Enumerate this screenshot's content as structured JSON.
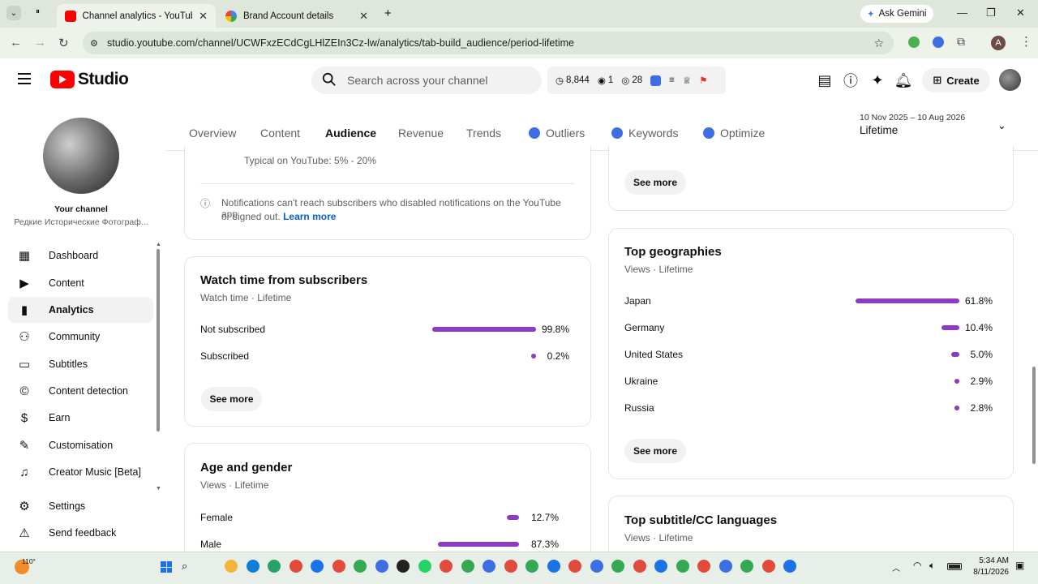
{
  "browser": {
    "tabs": [
      {
        "title": "Channel analytics - YouTube Stu",
        "active": true
      },
      {
        "title": "Brand Account details",
        "active": false
      }
    ],
    "ask_gemini": "Ask Gemini",
    "url": "studio.youtube.com/channel/UCWFxzECdCgLHlZEIn3Cz-lw/analytics/tab-build_audience/period-lifetime",
    "profile_initial": "A"
  },
  "header": {
    "logo_text": "Studio",
    "search_placeholder": "Search across your channel",
    "stats": {
      "watch": "8,844",
      "live": "1",
      "views": "28"
    },
    "create_label": "Create"
  },
  "sidebar": {
    "channel_label": "Your channel",
    "channel_name": "Редкие Исторические Фотограф...",
    "items": [
      {
        "label": "Dashboard",
        "icon": "dashboard-icon"
      },
      {
        "label": "Content",
        "icon": "content-icon"
      },
      {
        "label": "Analytics",
        "icon": "analytics-icon"
      },
      {
        "label": "Community",
        "icon": "community-icon"
      },
      {
        "label": "Subtitles",
        "icon": "subtitles-icon"
      },
      {
        "label": "Content detection",
        "icon": "copyright-icon"
      },
      {
        "label": "Earn",
        "icon": "dollar-icon"
      },
      {
        "label": "Customisation",
        "icon": "magic-wand-icon"
      },
      {
        "label": "Creator Music [Beta]",
        "icon": "music-icon"
      }
    ],
    "settings_label": "Settings",
    "feedback_label": "Send feedback"
  },
  "tabs": [
    "Overview",
    "Content",
    "Audience",
    "Revenue",
    "Trends",
    "Outliers",
    "Keywords",
    "Optimize"
  ],
  "period": {
    "range": "10 Nov 2025 – 10 Aug 2026",
    "label": "Lifetime"
  },
  "notif_card": {
    "typical": "Typical on YouTube: 5% - 20%",
    "note": "Notifications can't reach subscribers who disabled notifications on the YouTube app",
    "note2": "or signed out.",
    "learn_more": "Learn more"
  },
  "watch_time_card": {
    "title": "Watch time from subscribers",
    "subtitle": "Watch time · Lifetime",
    "rows": [
      {
        "label": "Not subscribed",
        "value": 99.8,
        "text": "99.8%"
      },
      {
        "label": "Subscribed",
        "value": 0.2,
        "text": "0.2%"
      }
    ],
    "see_more": "See more"
  },
  "age_gender_card": {
    "title": "Age and gender",
    "subtitle": "Views · Lifetime",
    "rows": [
      {
        "label": "Female",
        "value": 12.7,
        "text": "12.7%"
      },
      {
        "label": "Male",
        "value": 87.3,
        "text": "87.3%"
      }
    ]
  },
  "top_card": {
    "see_more": "See more"
  },
  "geo_card": {
    "title": "Top geographies",
    "subtitle": "Views · Lifetime",
    "rows": [
      {
        "label": "Japan",
        "value": 61.8,
        "text": "61.8%"
      },
      {
        "label": "Germany",
        "value": 10.4,
        "text": "10.4%"
      },
      {
        "label": "United States",
        "value": 5.0,
        "text": "5.0%"
      },
      {
        "label": "Ukraine",
        "value": 2.9,
        "text": "2.9%"
      },
      {
        "label": "Russia",
        "value": 2.8,
        "text": "2.8%"
      }
    ],
    "see_more": "See more"
  },
  "subtitle_card": {
    "title": "Top subtitle/CC languages",
    "subtitle": "Views · Lifetime"
  },
  "taskbar": {
    "temp": "110°",
    "time": "5:34 AM",
    "date": "8/11/2026"
  },
  "colors": {
    "bar": "#8e3ac2",
    "brand": "#ff0000"
  }
}
